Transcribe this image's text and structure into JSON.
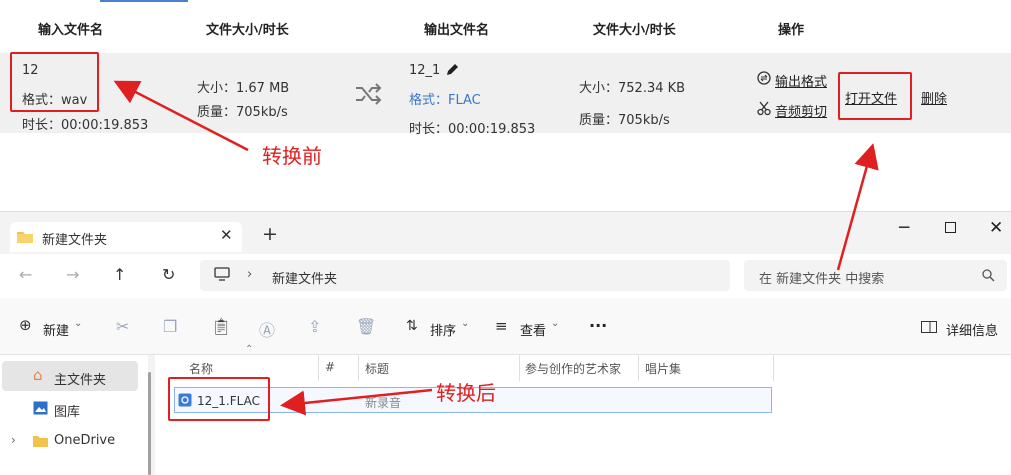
{
  "converter": {
    "headers": {
      "input_name": "输入文件名",
      "size_duration_in": "文件大小/时长",
      "output_name": "输出文件名",
      "size_duration_out": "文件大小/时长",
      "actions": "操作"
    },
    "input": {
      "name": "12",
      "format": "格式：wav",
      "duration": "时长：00:00:19.853"
    },
    "input_info": {
      "size": "大小：1.67 MB",
      "quality": "质量：705kb/s"
    },
    "output": {
      "name": "12_1",
      "format": "格式：FLAC",
      "duration": "时长：00:00:19.853"
    },
    "output_info": {
      "size": "大小：752.34 KB",
      "quality": "质量：705kb/s"
    },
    "actions": {
      "output_format": "输出格式",
      "audio_cut": "音频剪切",
      "open_file": "打开文件",
      "delete": "删除"
    },
    "annotation_before": "转换前"
  },
  "explorer": {
    "tab_title": "新建文件夹",
    "breadcrumb": "新建文件夹",
    "search_placeholder": "在 新建文件夹 中搜索",
    "toolbar": {
      "new": "新建",
      "sort": "排序",
      "view": "查看",
      "more": "···",
      "details": "详细信息"
    },
    "sidebar": [
      {
        "label": "主文件夹"
      },
      {
        "label": "图库"
      },
      {
        "label": "OneDrive"
      }
    ],
    "columns": {
      "name": "名称",
      "number": "#",
      "title": "标题",
      "artist": "参与创作的艺术家",
      "album": "唱片集"
    },
    "file": {
      "name": "12_1.FLAC",
      "title": "新录音"
    },
    "annotation_after": "转换后"
  },
  "colors": {
    "annotation": "#e02020",
    "accent": "#3b78c4"
  }
}
